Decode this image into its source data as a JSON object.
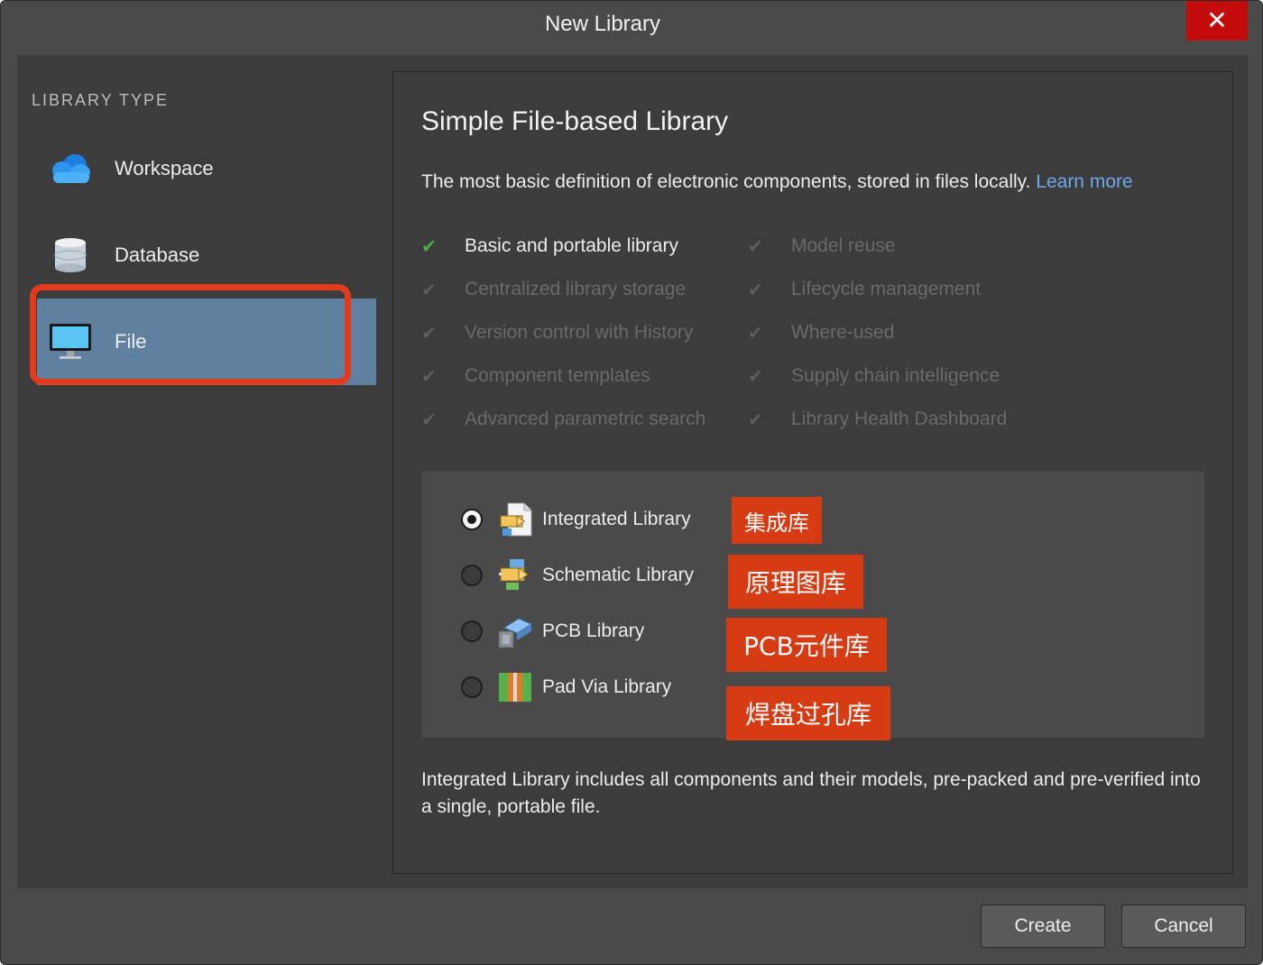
{
  "window": {
    "title": "New Library",
    "close_icon": "close-icon",
    "close_glyph": "✕"
  },
  "sidebar": {
    "heading": "LIBRARY TYPE",
    "items": [
      {
        "label": "Workspace",
        "icon": "cloud-icon",
        "selected": false
      },
      {
        "label": "Database",
        "icon": "database-icon",
        "selected": false
      },
      {
        "label": "File",
        "icon": "monitor-icon",
        "selected": true
      }
    ]
  },
  "panel": {
    "title": "Simple File-based Library",
    "description": "The most basic definition of electronic components, stored in files locally.",
    "learn_more": "Learn more",
    "features_left": [
      {
        "label": "Basic and portable library",
        "enabled": true
      },
      {
        "label": "Centralized library storage",
        "enabled": false
      },
      {
        "label": "Version control with History",
        "enabled": false
      },
      {
        "label": "Component templates",
        "enabled": false
      },
      {
        "label": "Advanced parametric search",
        "enabled": false
      }
    ],
    "features_right": [
      {
        "label": "Model reuse",
        "enabled": false
      },
      {
        "label": "Lifecycle management",
        "enabled": false
      },
      {
        "label": "Where-used",
        "enabled": false
      },
      {
        "label": "Supply chain intelligence",
        "enabled": false
      },
      {
        "label": "Library Health Dashboard",
        "enabled": false
      }
    ],
    "check_glyph": "✔",
    "options": [
      {
        "label": "Integrated Library",
        "selected": true,
        "icon": "integrated-library-icon",
        "annotation": "集成库"
      },
      {
        "label": "Schematic Library",
        "selected": false,
        "icon": "schematic-library-icon",
        "annotation": "原理图库"
      },
      {
        "label": "PCB Library",
        "selected": false,
        "icon": "pcb-library-icon",
        "annotation": "PCB元件库"
      },
      {
        "label": "Pad Via Library",
        "selected": false,
        "icon": "pad-via-library-icon",
        "annotation": "焊盘过孔库"
      }
    ],
    "footer_text": "Integrated Library includes all components and their models, pre-packed and pre-verified into a single, portable file."
  },
  "buttons": {
    "create": "Create",
    "cancel": "Cancel"
  },
  "colors": {
    "selection": "#60809f",
    "highlight_box": "#e23a1c",
    "annotation_bg": "#d73b14",
    "link": "#6ea8e8",
    "check_active": "#4bb04b",
    "close_button": "#c40b0b"
  }
}
